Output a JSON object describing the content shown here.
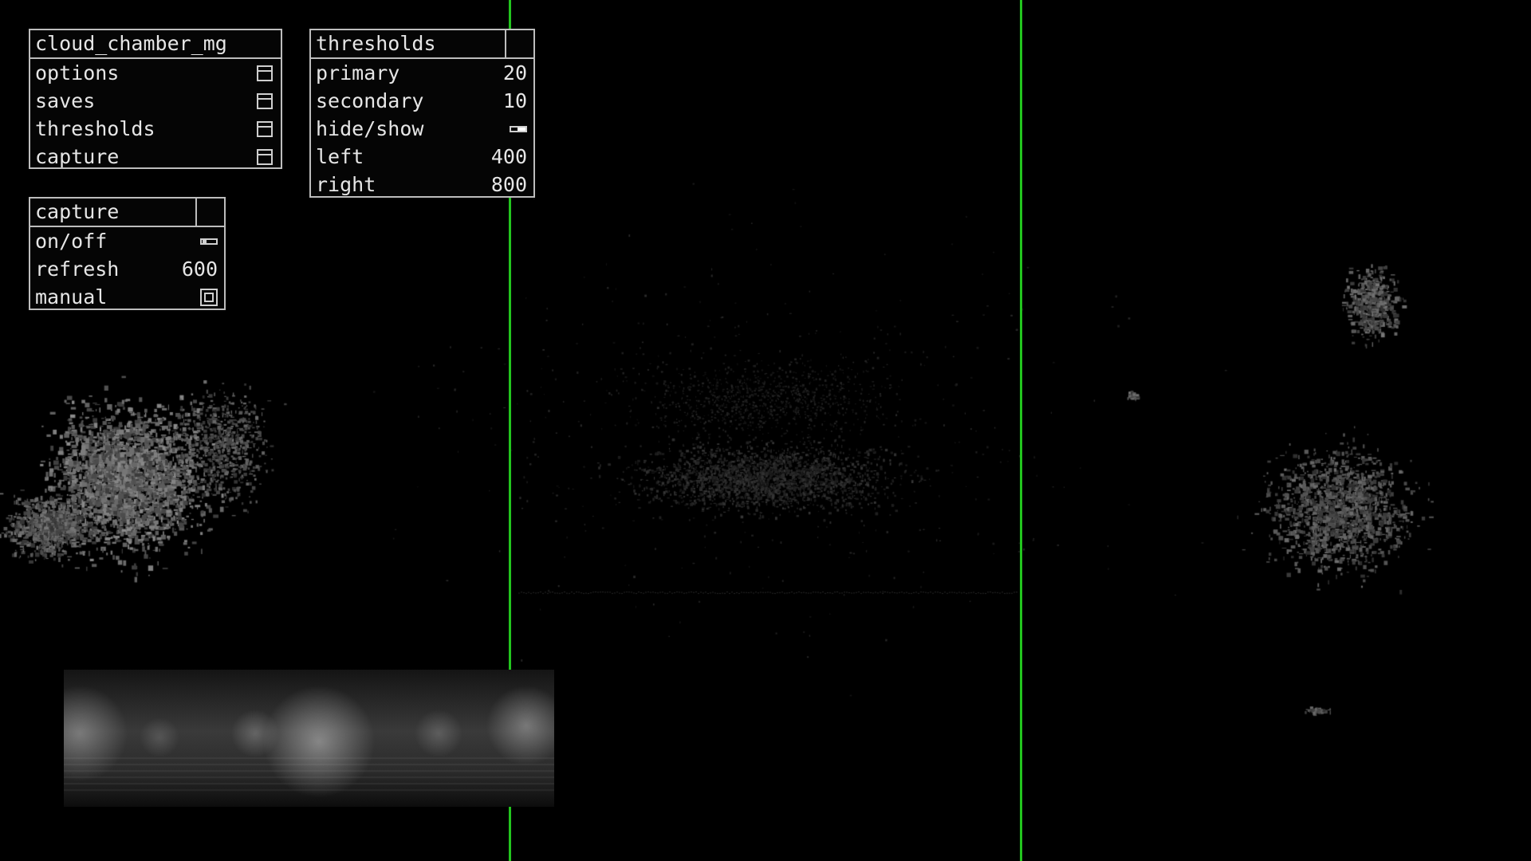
{
  "colors": {
    "background": "#000000",
    "guide_line": "#22c51e",
    "panel_border": "#bdbdbd",
    "panel_text": "#e6e6e6"
  },
  "main_panel": {
    "title": "cloud_chamber_mg",
    "items": [
      {
        "label": "options",
        "icon": "folder-icon"
      },
      {
        "label": "saves",
        "icon": "folder-icon"
      },
      {
        "label": "thresholds",
        "icon": "folder-icon"
      },
      {
        "label": "capture",
        "icon": "folder-icon"
      }
    ]
  },
  "thresholds_panel": {
    "title": "thresholds",
    "primary": {
      "label": "primary",
      "value": "20"
    },
    "secondary": {
      "label": "secondary",
      "value": "10"
    },
    "hide_show": {
      "label": "hide/show",
      "state": "on"
    },
    "left": {
      "label": "left",
      "value": "400"
    },
    "right": {
      "label": "right",
      "value": "800"
    }
  },
  "capture_panel": {
    "title": "capture",
    "on_off": {
      "label": "on/off",
      "state": "off"
    },
    "refresh": {
      "label": "refresh",
      "value": "600"
    },
    "manual": {
      "label": "manual",
      "icon": "square-button-icon"
    }
  }
}
